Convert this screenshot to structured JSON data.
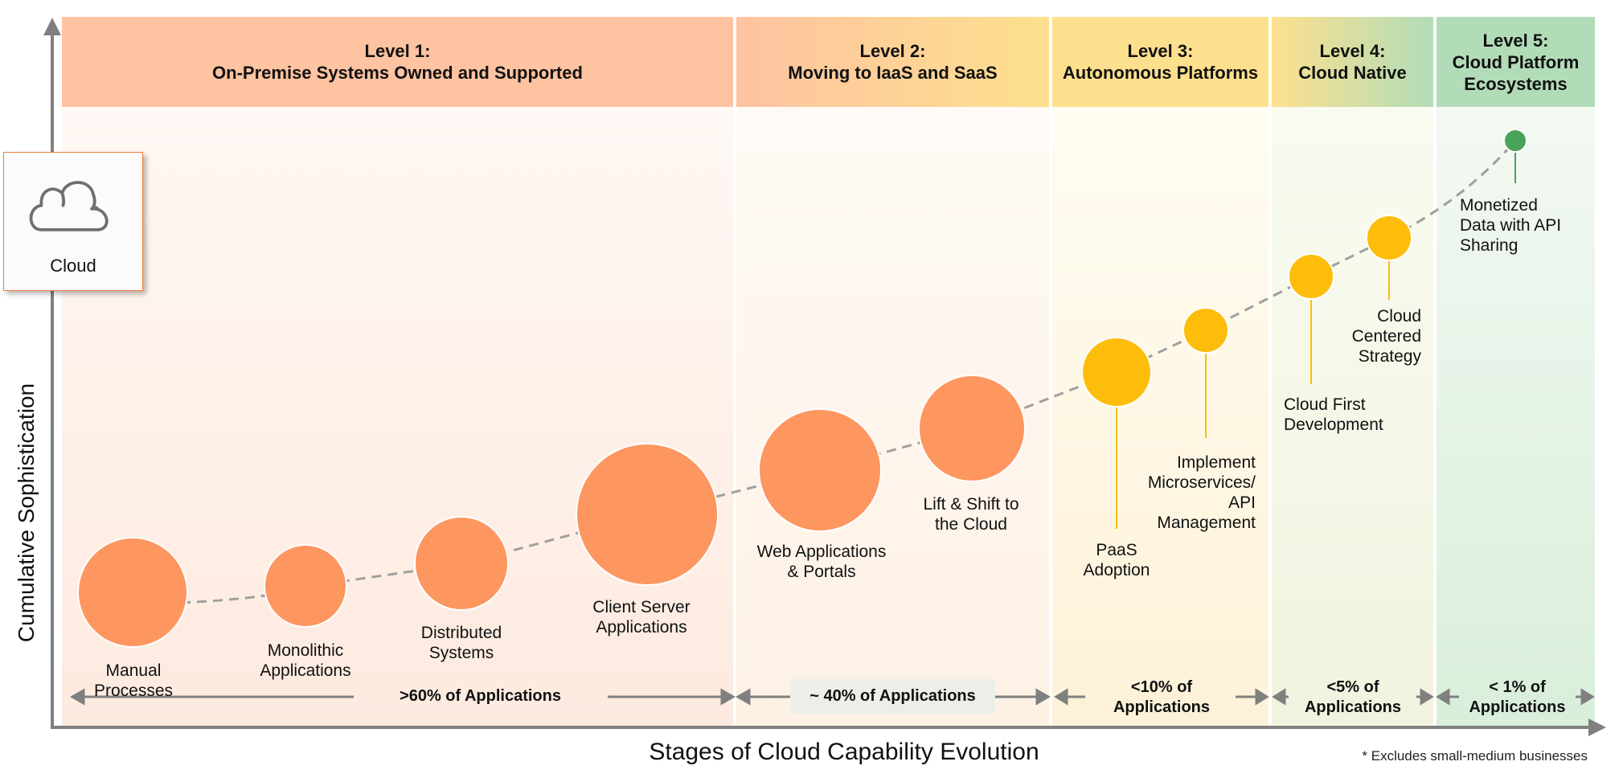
{
  "axes": {
    "y_label": "Cumulative Sophistication",
    "x_label": "Stages of Cloud Capability Evolution"
  },
  "footnote": "* Excludes small-medium businesses",
  "legend_box": {
    "icon": "cloud-icon",
    "label": "Cloud"
  },
  "colors": {
    "orange_bubble": "#fe9660",
    "yellow_bubble": "#fdbd0a",
    "green_bubble": "#4aa35a",
    "level1_header": "#fec3a1",
    "level2_header_start": "#fec3a1",
    "level2_header_end": "#fde08e",
    "level3_header": "#fde08e",
    "level4_header_start": "#fde08e",
    "level4_header_end": "#b2dcb8",
    "level5_header": "#b2dcb8",
    "axis": "#808080",
    "trend_line": "#a0a0a0"
  },
  "levels": [
    {
      "title": "Level 1:",
      "subtitle": "On-Premise Systems Owned and Supported",
      "share": ">60% of Applications"
    },
    {
      "title": "Level 2:",
      "subtitle": "Moving to IaaS and SaaS",
      "share": "~ 40% of Applications"
    },
    {
      "title": "Level 3:",
      "subtitle": "Autonomous Platforms",
      "share_line1": "<10% of",
      "share_line2": "Applications"
    },
    {
      "title": "Level 4:",
      "subtitle": "Cloud Native",
      "share_line1": "<5% of",
      "share_line2": "Applications"
    },
    {
      "title": "Level 5:",
      "subtitle_line1": "Cloud Platform",
      "subtitle_line2": "Ecosystems",
      "share_line1": "< 1% of",
      "share_line2": "Applications"
    }
  ],
  "stages": [
    {
      "label": [
        "Manual Processes"
      ],
      "level": 1,
      "color": "orange"
    },
    {
      "label": [
        "Monolithic",
        "Applications"
      ],
      "level": 1,
      "color": "orange"
    },
    {
      "label": [
        "Distributed",
        "Systems"
      ],
      "level": 1,
      "color": "orange"
    },
    {
      "label": [
        "Client Server",
        "Applications"
      ],
      "level": 1,
      "color": "orange"
    },
    {
      "label": [
        "Web Applications",
        "& Portals"
      ],
      "level": 2,
      "color": "orange"
    },
    {
      "label": [
        "Lift & Shift to",
        "the Cloud"
      ],
      "level": 2,
      "color": "orange"
    },
    {
      "label": [
        "PaaS",
        "Adoption"
      ],
      "level": 3,
      "color": "yellow"
    },
    {
      "label": [
        "Implement",
        "Microservices/",
        "API",
        "Management"
      ],
      "level": 3,
      "color": "yellow"
    },
    {
      "label": [
        "Cloud First",
        "Development"
      ],
      "level": 4,
      "color": "yellow"
    },
    {
      "label": [
        "Cloud",
        "Centered",
        "Strategy"
      ],
      "level": 4,
      "color": "yellow"
    },
    {
      "label": [
        "Monetized",
        "Data with API",
        "Sharing"
      ],
      "level": 5,
      "color": "green"
    }
  ]
}
